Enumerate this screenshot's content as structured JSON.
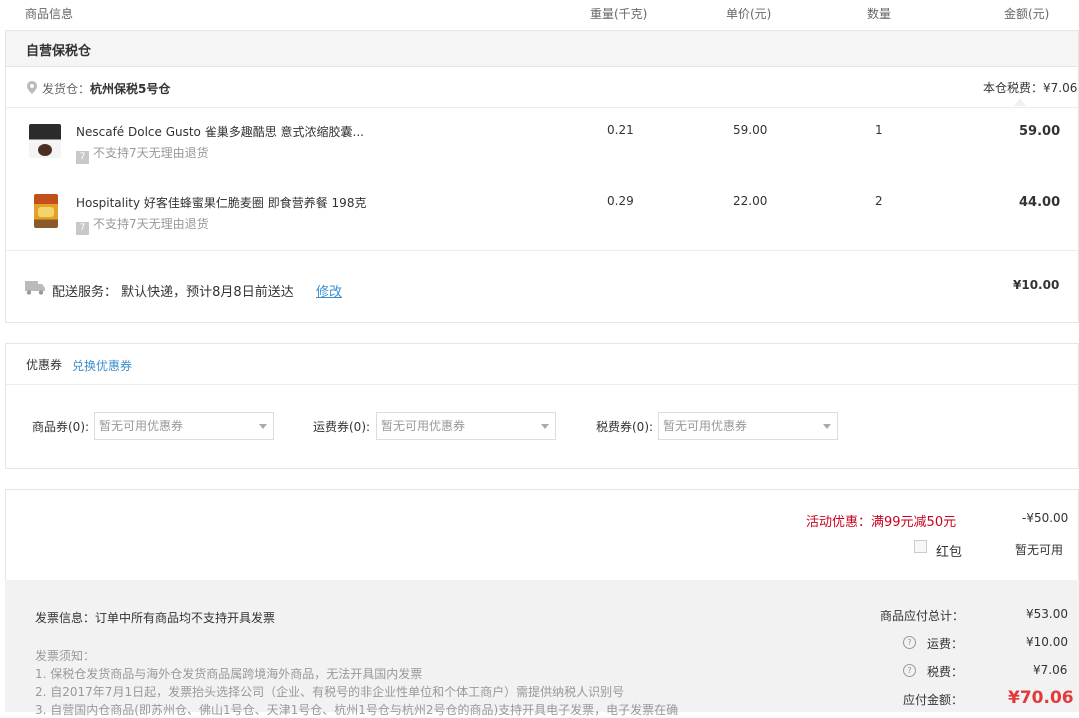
{
  "header": {
    "product_info": "商品信息",
    "weight": "重量(千克)",
    "unit_price": "单价(元)",
    "quantity": "数量",
    "amount": "金额(元)"
  },
  "warehouse": {
    "title": "自营保税仓",
    "ship_from_label": "发货仓：",
    "ship_from_value": "杭州保税5号仓",
    "tax_label": "本仓税费：",
    "tax_value": "¥7.06",
    "items": [
      {
        "name": "Nescafé Dolce Gusto 雀巢多趣酷思 意式浓缩胶囊...",
        "badge": "7",
        "return_policy": "不支持7天无理由退货",
        "weight": "0.21",
        "unit_price": "59.00",
        "quantity": "1",
        "amount": "59.00"
      },
      {
        "name": "Hospitality 好客佳蜂蜜果仁脆麦圈 即食营养餐 198克",
        "badge": "7",
        "return_policy": "不支持7天无理由退货",
        "weight": "0.29",
        "unit_price": "22.00",
        "quantity": "2",
        "amount": "44.00"
      }
    ],
    "delivery": {
      "label": "配送服务：",
      "value": "默认快递，预计8月8日前送达",
      "modify": "修改",
      "fee": "¥10.00"
    }
  },
  "coupons": {
    "title": "优惠券",
    "exchange_link": "兑换优惠券",
    "goods_label": "商品券(0):",
    "goods_placeholder": "暂无可用优惠券",
    "shipping_label": "运费券(0):",
    "shipping_placeholder": "暂无可用优惠券",
    "tax_label": "税费券(0):",
    "tax_placeholder": "暂无可用优惠券"
  },
  "promotion": {
    "label": "活动优惠：满99元减50元",
    "value": "-¥50.00",
    "red_packet_label": "红包",
    "red_packet_value": "暂无可用"
  },
  "invoice": {
    "info": "发票信息：订单中所有商品均不支持开具发票",
    "notice_title": "发票须知：",
    "notices": [
      "1. 保税仓发货商品与海外仓发货商品属跨境海外商品，无法开具国内发票",
      "2. 自2017年7月1日起，发票抬头选择公司（企业、有税号的非企业性单位和个体工商户）需提供纳税人识别号",
      "3. 自营国内仓商品(即苏州仓、佛山1号仓、天津1号仓、杭州1号仓与杭州2号仓的商品)支持开具电子发票，电子发票在确"
    ]
  },
  "summary": {
    "goods_total_label": "商品应付总计：",
    "goods_total_value": "¥53.00",
    "shipping_label": "运费：",
    "shipping_value": "¥10.00",
    "tax_label": "税费：",
    "tax_value": "¥7.06",
    "payable_label": "应付金额：",
    "payable_value": "¥70.06"
  },
  "colors": {
    "accent_red": "#e4393c",
    "link_blue": "#3b8fd1",
    "promo_red": "#c8001e"
  }
}
